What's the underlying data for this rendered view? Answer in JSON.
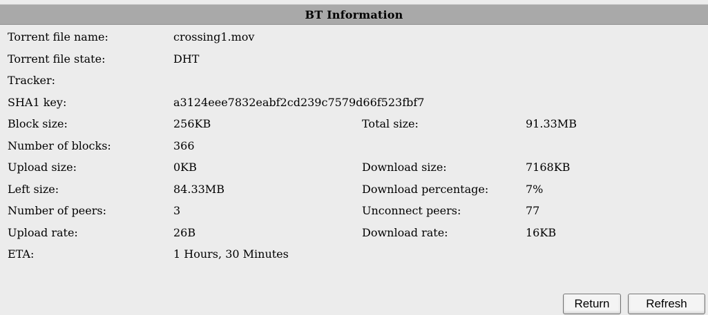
{
  "header": {
    "title": "BT Information"
  },
  "info": {
    "torrent_file_name": {
      "label": "Torrent file name:",
      "value": "crossing1.mov"
    },
    "torrent_file_state": {
      "label": "Torrent file state:",
      "value": "DHT"
    },
    "tracker": {
      "label": "Tracker:",
      "value": ""
    },
    "sha1_key": {
      "label": "SHA1 key:",
      "value": "a3124eee7832eabf2cd239c7579d66f523fbf7"
    },
    "block_size": {
      "label": "Block size:",
      "value": "256KB"
    },
    "total_size": {
      "label": "Total size:",
      "value": "91.33MB"
    },
    "number_of_blocks": {
      "label": "Number of blocks:",
      "value": "366"
    },
    "upload_size": {
      "label": "Upload size:",
      "value": "0KB"
    },
    "download_size": {
      "label": "Download size:",
      "value": "7168KB"
    },
    "left_size": {
      "label": "Left size:",
      "value": "84.33MB"
    },
    "download_percentage": {
      "label": "Download percentage:",
      "value": "7%"
    },
    "number_of_peers": {
      "label": "Number of peers:",
      "value": "3"
    },
    "unconnect_peers": {
      "label": "Unconnect peers:",
      "value": "77"
    },
    "upload_rate": {
      "label": "Upload rate:",
      "value": "26B"
    },
    "download_rate": {
      "label": "Download rate:",
      "value": "16KB"
    },
    "eta": {
      "label": "ETA:",
      "value": "1 Hours, 30 Minutes"
    }
  },
  "buttons": {
    "return_label": "Return",
    "refresh_label": "Refresh"
  }
}
